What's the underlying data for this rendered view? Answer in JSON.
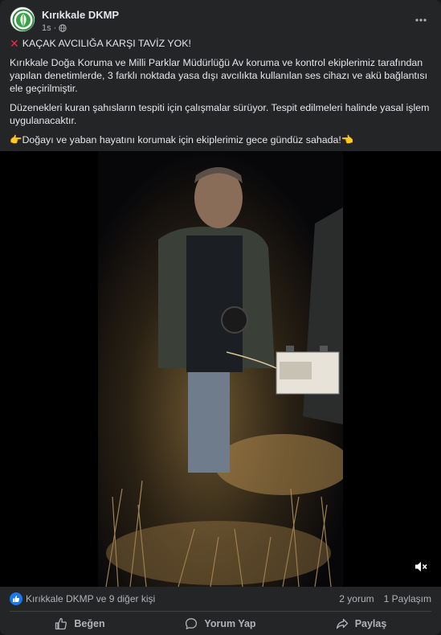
{
  "post": {
    "author": "Kırıkkale DKMP",
    "time": "1s",
    "headline": "KAÇAK AVCILIĞA KARŞI TAVİZ YOK!",
    "paragraph1": "Kırıkkale Doğa Koruma ve Milli Parklar Müdürlüğü Av koruma ve kontrol ekiplerimiz tarafından yapılan denetimlerde, 3 farklı noktada yasa dışı avcılıkta kullanılan ses cihazı ve akü bağlantısı ele geçirilmiştir.",
    "paragraph2": "Düzenekleri kuran şahısların tespiti için çalışmalar sürüyor. Tespit edilmeleri halinde yasal işlem uygulanacaktır.",
    "closing": "Doğayı ve yaban hayatını korumak için ekiplerimiz gece gündüz sahada!",
    "icons": {
      "headline": "red-x-icon",
      "closing_left": "pointing-hand-icon",
      "closing_right": "pointing-hand-icon",
      "audience": "globe-icon",
      "more": "three-dots-icon",
      "mute": "speaker-muted-icon"
    }
  },
  "reactions": {
    "summary": "Kırıkkale DKMP ve 9 diğer kişi",
    "comments": "2 yorum",
    "shares": "1 Paylaşım"
  },
  "actions": {
    "like": "Beğen",
    "comment": "Yorum Yap",
    "share": "Paylaş"
  },
  "colors": {
    "card_bg": "#242526",
    "text": "#e4e6eb",
    "secondary_text": "#b0b3b8",
    "like_blue": "#1877f2",
    "logo_green": "#2e8b3e"
  }
}
